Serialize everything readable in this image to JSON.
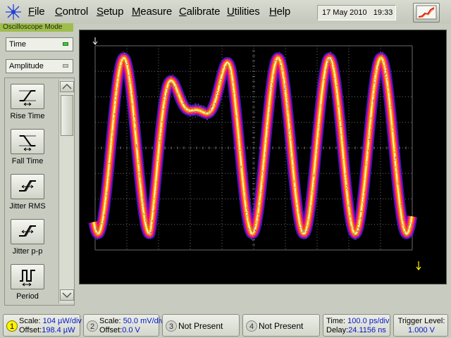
{
  "menubar": {
    "items": [
      {
        "label": "File",
        "accel_index": 0
      },
      {
        "label": "Control",
        "accel_index": 0
      },
      {
        "label": "Setup",
        "accel_index": 0
      },
      {
        "label": "Measure",
        "accel_index": 0
      },
      {
        "label": "Calibrate",
        "accel_index": 0
      },
      {
        "label": "Utilities",
        "accel_index": 0
      },
      {
        "label": "Help",
        "accel_index": 0
      }
    ],
    "date": "17 May 2010",
    "time": "19:33"
  },
  "left_panel": {
    "mode": "Oscilloscope Mode",
    "time_combo": "Time",
    "amplitude_combo": "Amplitude",
    "measurements": [
      {
        "label": "Rise Time",
        "icon": "rise-time-icon"
      },
      {
        "label": "Fall Time",
        "icon": "fall-time-icon"
      },
      {
        "label": "Jitter RMS",
        "icon": "jitter-rms-icon"
      },
      {
        "label": "Jitter p-p",
        "icon": "jitter-pp-icon"
      },
      {
        "label": "Period",
        "icon": "period-icon"
      }
    ]
  },
  "colors": {
    "channel1": "#fff200",
    "status_led": "#2fd43a",
    "value_text": "#0016c8",
    "graticule": "#6a6a6a",
    "persistence": [
      "#3a40ff",
      "#b300d0",
      "#ff1b6b",
      "#ff6a00",
      "#ffc400",
      "#ffffff"
    ]
  },
  "channels": [
    {
      "num": "1",
      "scale": "Scale: ",
      "scale_value": "104 µW/div",
      "offset": "Offset:",
      "offset_value": "198.4 µW",
      "active": true
    },
    {
      "num": "2",
      "scale": "Scale: ",
      "scale_value": "50.0 mV/div",
      "offset": "Offset:",
      "offset_value": "0.0 V",
      "active": false
    },
    {
      "num": "3",
      "status": "Not Present"
    },
    {
      "num": "4",
      "status": "Not Present"
    }
  ],
  "timebase": {
    "time_label": "Time: ",
    "time_value": "100.0 ps/div",
    "delay_label": "Delay:",
    "delay_value": "24.1156 ns"
  },
  "trigger": {
    "label": "Trigger Level:",
    "value": "1.000 V"
  }
}
